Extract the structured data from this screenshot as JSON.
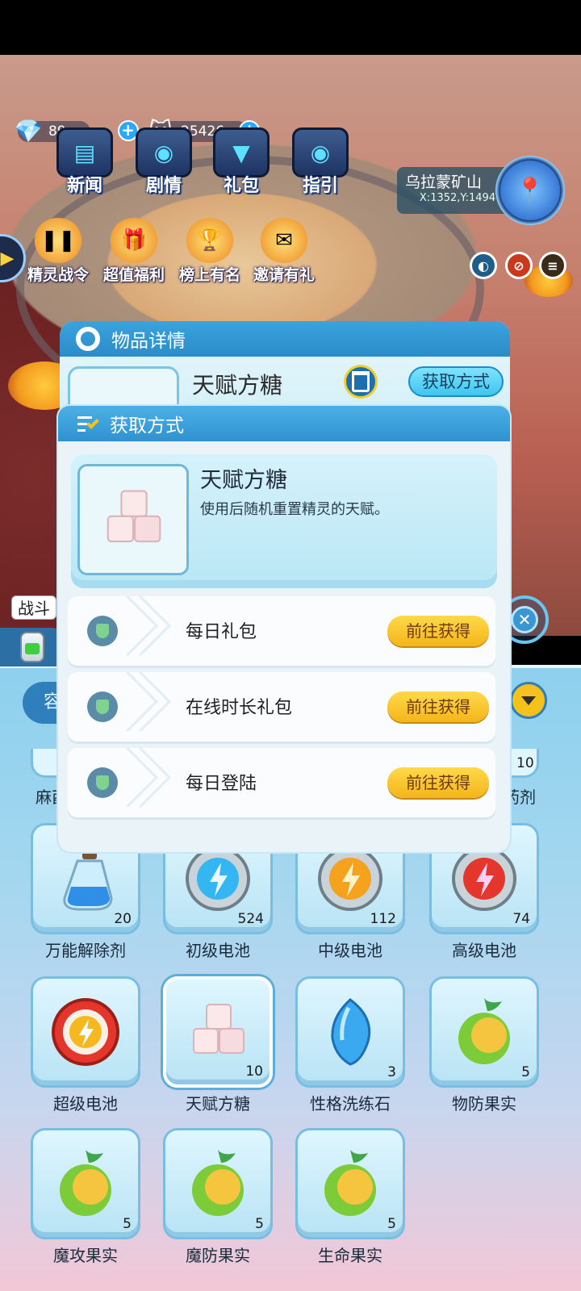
{
  "hud": {
    "gems": "89",
    "coins": "25426"
  },
  "menu": [
    {
      "label": "新闻"
    },
    {
      "label": "剧情"
    },
    {
      "label": "礼包"
    },
    {
      "label": "指引"
    }
  ],
  "activities": [
    {
      "label": "精灵战令"
    },
    {
      "label": "超值福利"
    },
    {
      "label": "榜上有名"
    },
    {
      "label": "邀请有礼"
    }
  ],
  "location": {
    "name": "乌拉蒙矿山",
    "coords": "X:1352,Y:1494"
  },
  "battle_label": "战斗",
  "inventory": {
    "filter": "容",
    "partial_left_label": "麻酉",
    "partial_right_label": "药剂",
    "partial_right_count": "10",
    "items": [
      {
        "name": "万能解除剂",
        "count": "20"
      },
      {
        "name": "初级电池",
        "count": "524"
      },
      {
        "name": "中级电池",
        "count": "112"
      },
      {
        "name": "高级电池",
        "count": "74"
      },
      {
        "name": "超级电池",
        "count": ""
      },
      {
        "name": "天赋方糖",
        "count": "10"
      },
      {
        "name": "性格洗练石",
        "count": "3"
      },
      {
        "name": "物防果实",
        "count": "5"
      },
      {
        "name": "魔攻果实",
        "count": "5"
      },
      {
        "name": "魔防果实",
        "count": "5"
      },
      {
        "name": "生命果实",
        "count": "5"
      }
    ]
  },
  "item_detail": {
    "title": "物品详情",
    "name": "天赋方糖",
    "obtain_button": "获取方式"
  },
  "obtain_dialog": {
    "title": "获取方式",
    "item_name": "天赋方糖",
    "item_desc": "使用后随机重置精灵的天赋。",
    "sources": [
      {
        "label": "每日礼包",
        "button": "前往获得"
      },
      {
        "label": "在线时长礼包",
        "button": "前往获得"
      },
      {
        "label": "每日登陆",
        "button": "前往获得"
      }
    ]
  }
}
